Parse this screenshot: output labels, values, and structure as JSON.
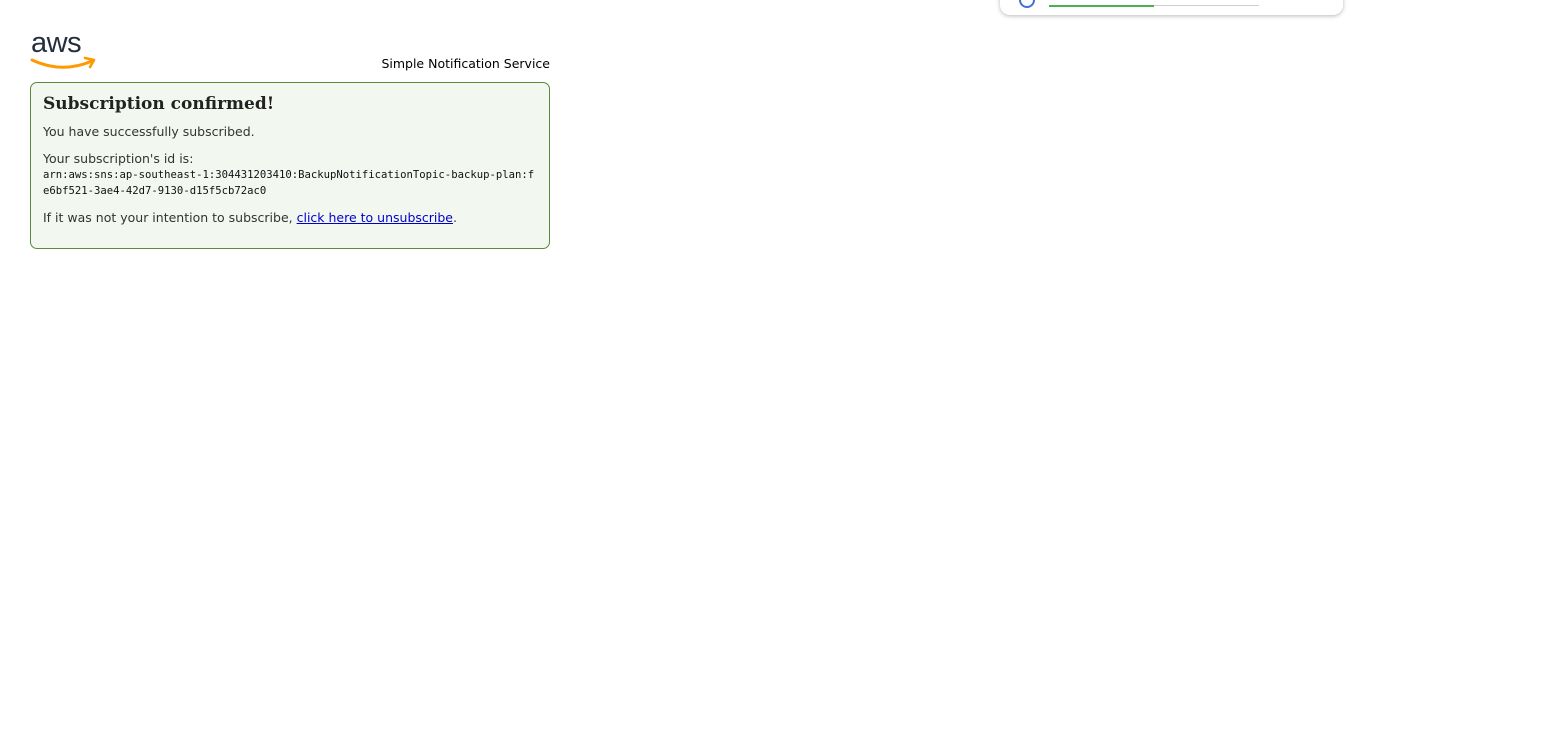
{
  "popup": {
    "progress": 0.5
  },
  "header": {
    "logo_text": "aws",
    "service_name": "Simple Notification Service"
  },
  "confirmation": {
    "title": "Subscription confirmed!",
    "success_message": "You have successfully subscribed.",
    "id_label": "Your subscription's id is:",
    "subscription_arn": "arn:aws:sns:ap-southeast-1:304431203410:BackupNotificationTopic-backup-plan:fe6bf521-3ae4-42d7-9130-d15f5cb72ac0",
    "unsubscribe_prefix": "If it was not your intention to subscribe, ",
    "unsubscribe_link": "click here to unsubscribe",
    "unsubscribe_suffix": "."
  },
  "colors": {
    "box_border": "#5a8a3a",
    "box_background": "#f2f8f0",
    "link": "#0000cc",
    "aws_orange": "#ff9900",
    "aws_text": "#232f3e"
  }
}
